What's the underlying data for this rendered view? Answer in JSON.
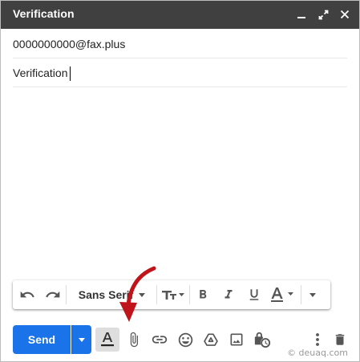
{
  "window": {
    "title": "Verification",
    "controls": [
      "minimize-icon",
      "expand-icon",
      "close-icon"
    ]
  },
  "compose": {
    "to": "0000000000@fax.plus",
    "subject": "Verification",
    "body": ""
  },
  "formatting_toolbar": {
    "buttons": [
      "undo-icon",
      "redo-icon",
      "font-dropdown",
      "font-size-icon",
      "bold-icon",
      "italic-icon",
      "underline-icon",
      "text-color-icon",
      "more-formatting-icon"
    ],
    "font": "Sans Serif"
  },
  "bottom_toolbar": {
    "send_label": "Send",
    "icons": [
      "formatting-options-icon",
      "attach-file-icon",
      "insert-link-icon",
      "insert-emoji-icon",
      "google-drive-icon",
      "insert-photo-icon",
      "confidential-mode-icon",
      "more-options-icon",
      "discard-draft-icon"
    ]
  },
  "annotation": {
    "arrow_color": "#c0141c",
    "target": "attach-file-icon"
  },
  "watermark": "© deuaq.com",
  "colors": {
    "titlebar": "#404040",
    "send": "#1a73e8"
  }
}
